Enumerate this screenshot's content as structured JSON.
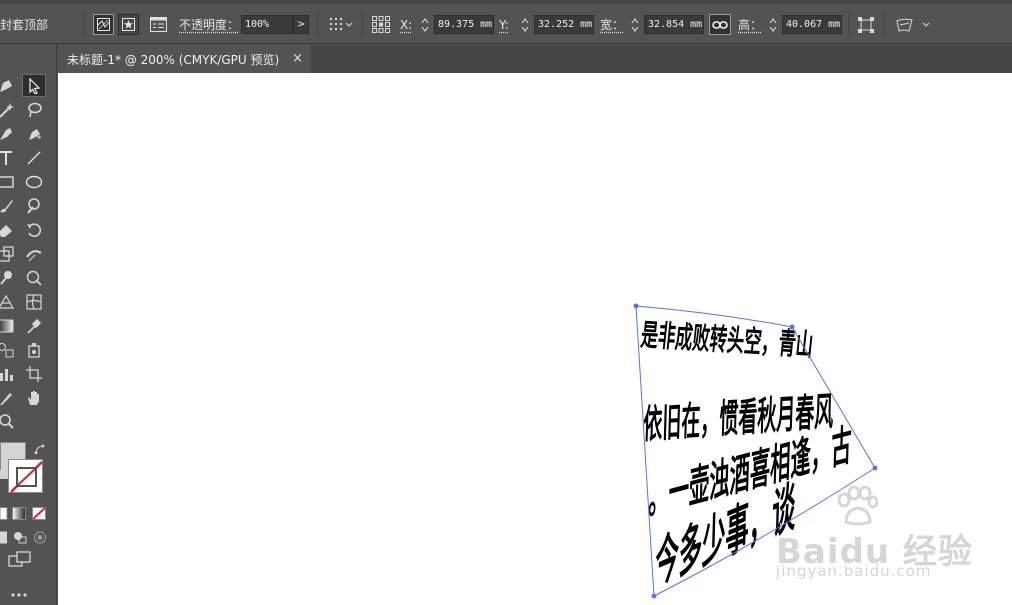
{
  "control_bar": {
    "selection_label": "封套顶部",
    "opacity_label": "不透明度：",
    "opacity_value": "100%",
    "opacity_arrow": ">",
    "x_label": "X:",
    "x_value": "89.375 mm",
    "y_label": "Y:",
    "y_value": "32.252 mm",
    "width_label": "宽：",
    "width_value": "32.854 mm",
    "height_label": "高：",
    "height_value": "40.067 mm"
  },
  "document_tab": {
    "title": "未标题-1* @ 200% (CMYK/GPU 预览)",
    "close_glyph": "×"
  },
  "tools": [
    "pen-tool",
    "direct-selection-tool",
    "magic-wand-tool",
    "lasso-tool",
    "curvature-tool",
    "add-anchor-tool",
    "type-tool",
    "line-tool",
    "rectangle-tool",
    "ellipse-tool",
    "paintbrush-tool",
    "blob-brush-tool",
    "eraser-tool",
    "rotate-tool",
    "scale-tool",
    "width-tool",
    "puppet-warp-tool",
    "shape-builder-tool",
    "perspective-grid-tool",
    "mesh-tool",
    "gradient-tool",
    "eyedropper-tool",
    "blend-tool",
    "symbol-sprayer-tool",
    "column-graph-tool",
    "artboard-tool",
    "slice-tool",
    "hand-tool",
    "zoom-tool"
  ],
  "canvas": {
    "text_lines": [
      "是非成败转头空，青山",
      "依旧在，惯看秋月春风",
      "。一壶浊酒喜相逢，古",
      "今多少事，谈"
    ],
    "envelope_color": "#5577e6",
    "text_color": "#000000"
  },
  "watermark": {
    "main": "Baidu 经验",
    "sub": "jingyan.baidu.com"
  },
  "colors": {
    "ui_background": "#535353",
    "ui_dark": "#454545",
    "field_background": "#3a3a3a",
    "canvas": "#ffffff",
    "fill_swatch": "#d4d4d4",
    "stroke_none": "#e02020"
  }
}
